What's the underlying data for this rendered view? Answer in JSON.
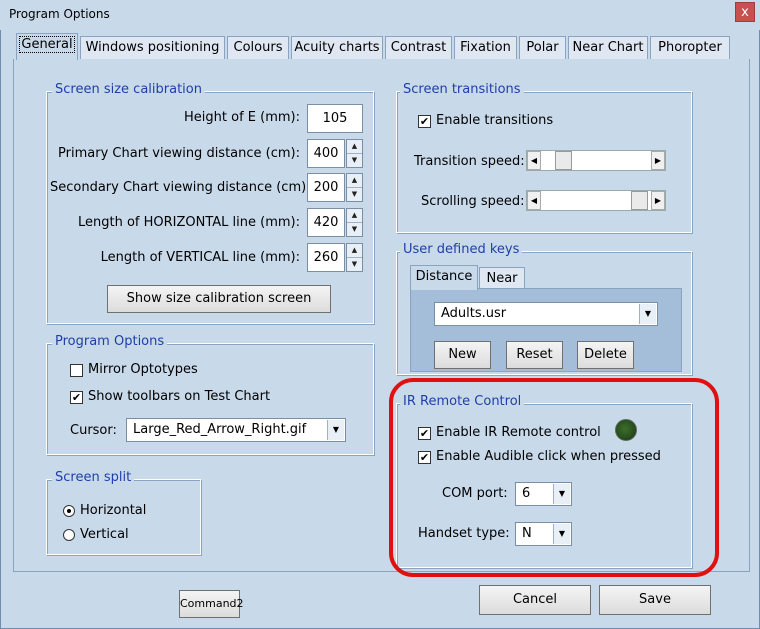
{
  "window": {
    "title": "Program Options",
    "close_label": "x"
  },
  "tabs": [
    {
      "label": "General"
    },
    {
      "label": "Windows positioning"
    },
    {
      "label": "Colours"
    },
    {
      "label": "Acuity charts"
    },
    {
      "label": "Contrast"
    },
    {
      "label": "Fixation"
    },
    {
      "label": "Polar"
    },
    {
      "label": "Near Chart"
    },
    {
      "label": "Phoropter"
    }
  ],
  "screen_calibration": {
    "title": "Screen size calibration",
    "rows": [
      {
        "label": "Height of E (mm):",
        "value": "105"
      },
      {
        "label": "Primary Chart viewing distance (cm):",
        "value": "400"
      },
      {
        "label": "Secondary Chart viewing distance (cm):",
        "value": "200"
      },
      {
        "label": "Length of HORIZONTAL line (mm):",
        "value": "420"
      },
      {
        "label": "Length of VERTICAL line (mm):",
        "value": "260"
      }
    ],
    "show_button": "Show size calibration screen"
  },
  "program_options": {
    "title": "Program Options",
    "mirror_label": "Mirror Optotypes",
    "mirror_checked": false,
    "toolbars_label": "Show toolbars on Test Chart",
    "toolbars_checked": true,
    "cursor_label": "Cursor:",
    "cursor_value": "Large_Red_Arrow_Right.gif"
  },
  "screen_split": {
    "title": "Screen split",
    "horizontal": "Horizontal",
    "vertical": "Vertical",
    "selected": "Horizontal"
  },
  "transitions": {
    "title": "Screen transitions",
    "enable_label": "Enable transitions",
    "enable_checked": true,
    "speed_label": "Transition speed:",
    "speed_level": 0.15,
    "scroll_label": "Scrolling speed:",
    "scroll_level": 0.95
  },
  "user_keys": {
    "title": "User defined keys",
    "tabs": [
      "Distance",
      "Near"
    ],
    "file_value": "Adults.usr",
    "new_label": "New",
    "reset_label": "Reset",
    "delete_label": "Delete"
  },
  "ir_remote": {
    "title": "IR Remote Control",
    "enable_label": "Enable IR Remote control",
    "enable_checked": true,
    "audible_label": "Enable Audible click when pressed",
    "audible_checked": true,
    "com_label": "COM port:",
    "com_value": "6",
    "handset_label": "Handset type:",
    "handset_value": "N"
  },
  "footer": {
    "command_label": "Command2",
    "cancel_label": "Cancel",
    "save_label": "Save"
  },
  "glyphs": {
    "check": "✔",
    "up": "▲",
    "down": "▼",
    "left": "◀",
    "right": "▶"
  }
}
